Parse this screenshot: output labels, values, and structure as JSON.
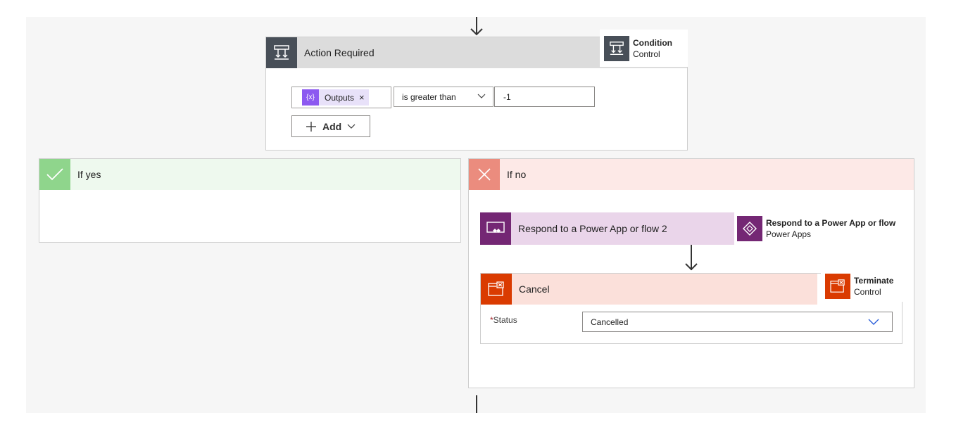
{
  "condition": {
    "title": "Action Required",
    "tooltip_title": "Condition",
    "tooltip_subtitle": "Control",
    "token_label": "Outputs",
    "token_remove": "×",
    "operator": "is greater than",
    "value": "-1",
    "add_label": "Add"
  },
  "yes_branch": {
    "title": "If yes"
  },
  "no_branch": {
    "title": "If no"
  },
  "respond_action": {
    "title": "Respond to a Power App or flow 2",
    "tooltip_title": "Respond to a Power App or flow",
    "tooltip_subtitle": "Power Apps"
  },
  "cancel_action": {
    "title": "Cancel",
    "tooltip_title": "Terminate",
    "tooltip_subtitle": "Control",
    "status_required_mark": "*",
    "status_label": "Status",
    "status_value": "Cancelled"
  },
  "colors": {
    "control_dark": "#484f58",
    "yes_green": "#8fd58c",
    "yes_header_bg": "#eef9ee",
    "no_red": "#eb8c7e",
    "no_header_bg": "#fde9e7",
    "powerapps_purple": "#742774",
    "terminate_orange": "#da3b01"
  }
}
